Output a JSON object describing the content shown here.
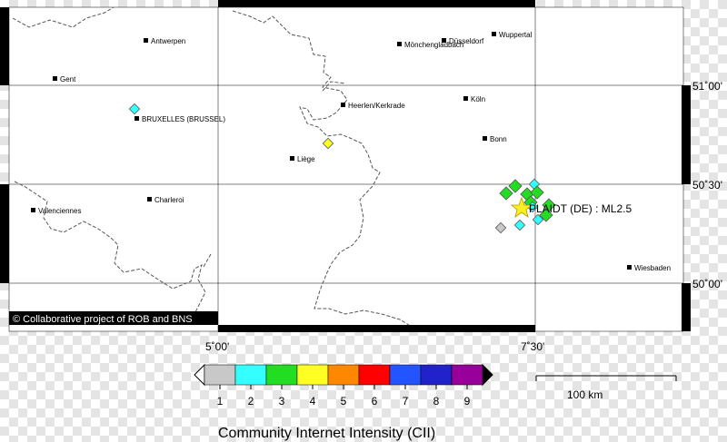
{
  "map": {
    "cities": [
      {
        "name": "Antwerpen"
      },
      {
        "name": "Gent"
      },
      {
        "name": "BRUXELLES (BRUSSEL)"
      },
      {
        "name": "Charleroi"
      },
      {
        "name": "Valenciennes"
      },
      {
        "name": "Liège"
      },
      {
        "name": "Heerlen/Kerkrade"
      },
      {
        "name": "Mönchengladbach"
      },
      {
        "name": "Düsseldorf"
      },
      {
        "name": "Wuppertal"
      },
      {
        "name": "Köln"
      },
      {
        "name": "Bonn"
      },
      {
        "name": "Wiesbaden"
      }
    ],
    "axis_labels": {
      "lon_left": "5˚00'",
      "lon_right": "7˚30'",
      "lat_top": "51˚00'",
      "lat_mid": "50˚30'",
      "lat_bottom": "50˚00'"
    },
    "event_label": "PLAIDT (DE) : ML2.5",
    "credit": "© Collaborative project of ROB and BNS",
    "scale_label": "100 km"
  },
  "legend": {
    "title": "Community Internet Intensity (CII)",
    "classes": [
      {
        "value": "1",
        "color": "#c8c8c8"
      },
      {
        "value": "2",
        "color": "#33ffff"
      },
      {
        "value": "3",
        "color": "#22dd22"
      },
      {
        "value": "4",
        "color": "#ffff22"
      },
      {
        "value": "5",
        "color": "#ff8800"
      },
      {
        "value": "6",
        "color": "#ff0000"
      },
      {
        "value": "7",
        "color": "#2255ff"
      },
      {
        "value": "8",
        "color": "#2222cc"
      },
      {
        "value": "9",
        "color": "#990099"
      }
    ]
  },
  "colors": {
    "epicenter": "#ffee22",
    "diamond_outline": "#555555",
    "grid": "#000000",
    "border_dashed": "#555555"
  },
  "icons": {
    "city": "square-marker-icon",
    "epicenter": "star-icon",
    "report": "diamond-marker-icon"
  }
}
